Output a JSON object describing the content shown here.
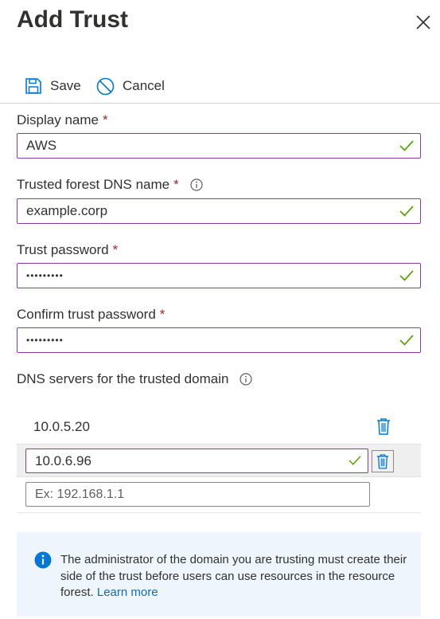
{
  "panel": {
    "title": "Add Trust"
  },
  "toolbar": {
    "save_label": "Save",
    "cancel_label": "Cancel"
  },
  "fields": {
    "display_name": {
      "label": "Display name",
      "required_mark": "*",
      "value": "AWS"
    },
    "forest_dns": {
      "label": "Trusted forest DNS name",
      "required_mark": "*",
      "value": "example.corp"
    },
    "trust_password": {
      "label": "Trust password",
      "required_mark": "*",
      "value": "•••••••••"
    },
    "confirm_password": {
      "label": "Confirm trust password",
      "required_mark": "*",
      "value": "•••••••••"
    }
  },
  "dns_servers": {
    "label": "DNS servers for the trusted domain",
    "entries": [
      "10.0.5.20",
      "10.0.6.96"
    ],
    "new_placeholder": "Ex: 192.168.1.1"
  },
  "info_bar": {
    "text": "The administrator of the domain you are trusting must create their side of the trust before users can use resources in the resource forest.",
    "link_text": "Learn more"
  },
  "colors": {
    "accent": "#0078d4",
    "success": "#57a300",
    "required": "#a4262c",
    "input_border": "#8a3aa0",
    "info_bg": "#eef5fc"
  },
  "icons": {
    "close": "close-icon",
    "save": "save-icon",
    "cancel": "cancel-icon",
    "info": "info-icon",
    "check": "checkmark-icon",
    "trash": "trash-icon"
  }
}
